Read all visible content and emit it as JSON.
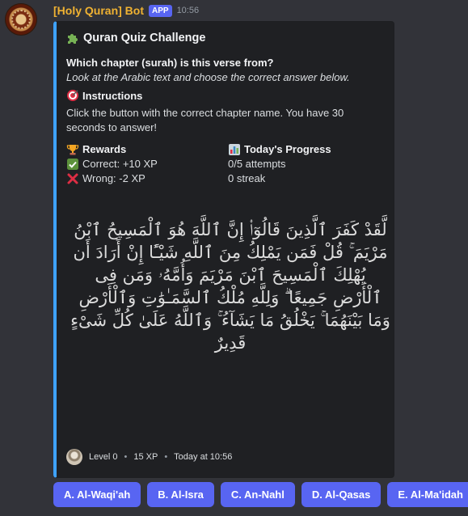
{
  "message": {
    "username": "[Holy Quran] Bot",
    "app_badge": "APP",
    "timestamp": "10:56"
  },
  "embed": {
    "title": "Quran Quiz Challenge",
    "title_icon": "puzzle-icon",
    "question_bold": "Which chapter (surah) is this verse from?",
    "question_italic": "Look at the Arabic text and choose the correct answer below.",
    "instructions_title": "Instructions",
    "instructions_icon": "target-icon",
    "instructions_text": "Click the button with the correct chapter name. You have 30 seconds to answer!",
    "rewards": {
      "title": "Rewards",
      "icon": "trophy-icon",
      "correct": "Correct: +10 XP",
      "correct_icon": "check-mark-icon",
      "wrong": "Wrong: -2 XP",
      "wrong_icon": "cross-mark-icon"
    },
    "progress": {
      "title": "Today's Progress",
      "icon": "bar-chart-icon",
      "attempts": "0/5 attempts",
      "streak": "0 streak"
    },
    "verse": "لَّقَدْ كَفَرَ ٱلَّذِينَ قَالُوٓا۟ إِنَّ ٱللَّهَ هُوَ ٱلْمَسِيحُ ٱبْنُ مَرْيَمَ ۚ قُلْ فَمَن يَمْلِكُ مِنَ ٱللَّهِ شَيْـًٔا إِنْ أَرَادَ أَن يُهْلِكَ ٱلْمَسِيحَ ٱبْنَ مَرْيَمَ وَأُمَّهُۥ وَمَن فِى ٱلْأَرْضِ جَمِيعًا ۗ وَلِلَّهِ مُلْكُ ٱلسَّمَـٰوَٰتِ وَٱلْأَرْضِ وَمَا بَيْنَهُمَا ۚ يَخْلُقُ مَا يَشَآءُ ۚ وَٱللَّهُ عَلَىٰ كُلِّ شَىْءٍ قَدِيرٌ",
    "footer": {
      "level": "Level 0",
      "xp": "15 XP",
      "time": "Today at 10:56"
    },
    "accent_color": "#3ea2ff"
  },
  "buttons": [
    {
      "label": "A. Al-Waqi'ah"
    },
    {
      "label": "B. Al-Isra"
    },
    {
      "label": "C. An-Nahl"
    },
    {
      "label": "D. Al-Qasas"
    },
    {
      "label": "E. Al-Ma'idah"
    }
  ],
  "colors": {
    "button": "#5865f2",
    "username": "#f0b232",
    "background": "#323339"
  }
}
